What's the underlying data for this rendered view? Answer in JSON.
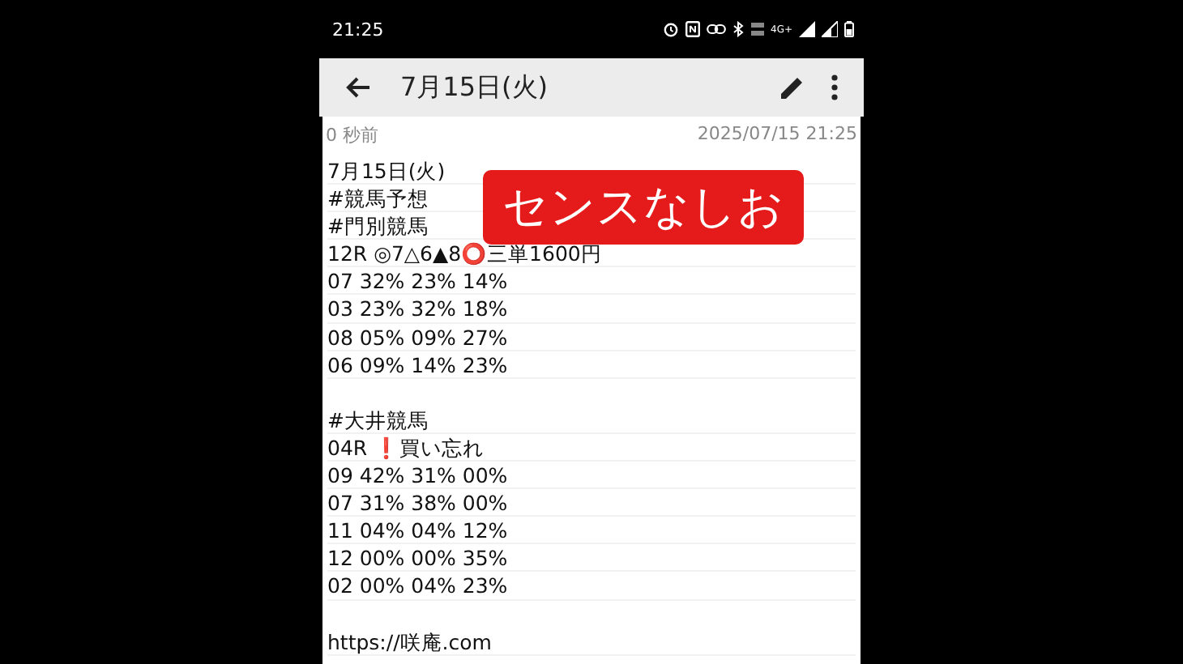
{
  "status_bar": {
    "time": "21:25",
    "network": "4G+"
  },
  "app_bar": {
    "title": "7月15日(火)"
  },
  "meta": {
    "elapsed": "0 秒前",
    "timestamp": "2025/07/15 21:25"
  },
  "note_sections": [
    {
      "lines": [
        "7月15日(火)",
        "#競馬予想",
        "#門別競馬",
        "12R ◎7△6▲8⭕三単1600円",
        "07 32% 23% 14%",
        "03 23% 32% 18%",
        "08 05% 09% 27%",
        "06 09% 14% 23%"
      ]
    },
    {
      "lines": [
        "#大井競馬",
        "04R ❗買い忘れ",
        "09 42% 31% 00%",
        "07 31% 38% 00%",
        "11 04% 04% 12%",
        "12 00% 00% 35%",
        "02 00% 04% 23%"
      ]
    },
    {
      "lines": [
        "https://咲庵.com"
      ]
    }
  ],
  "overlay_caption": "センスなしお"
}
